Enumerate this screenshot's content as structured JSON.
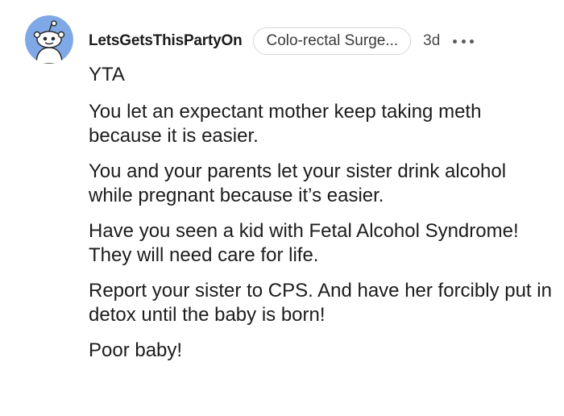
{
  "comment": {
    "username": "LetsGetsThisPartyOn",
    "flair": "Colo-rectal Surge...",
    "time": "3d",
    "paragraphs": [
      "YTA",
      "You let an expectant mother keep taking meth because it is easier.",
      "You and your parents let your sister drink alcohol while pregnant because it’s easier.",
      "Have you seen a kid with Fetal Alcohol Syndrome! They will need care for life.",
      "Report your sister to CPS. And have her forcibly put in detox until the baby is born!",
      "Poor baby!"
    ]
  },
  "icons": {
    "avatar": "reddit-snoo-avatar-icon",
    "more": "more-options-icon"
  },
  "colors": {
    "avatar_bg": "#7fa8e6",
    "text": "#1c1c1c",
    "flair_border": "#d6d6d6"
  }
}
